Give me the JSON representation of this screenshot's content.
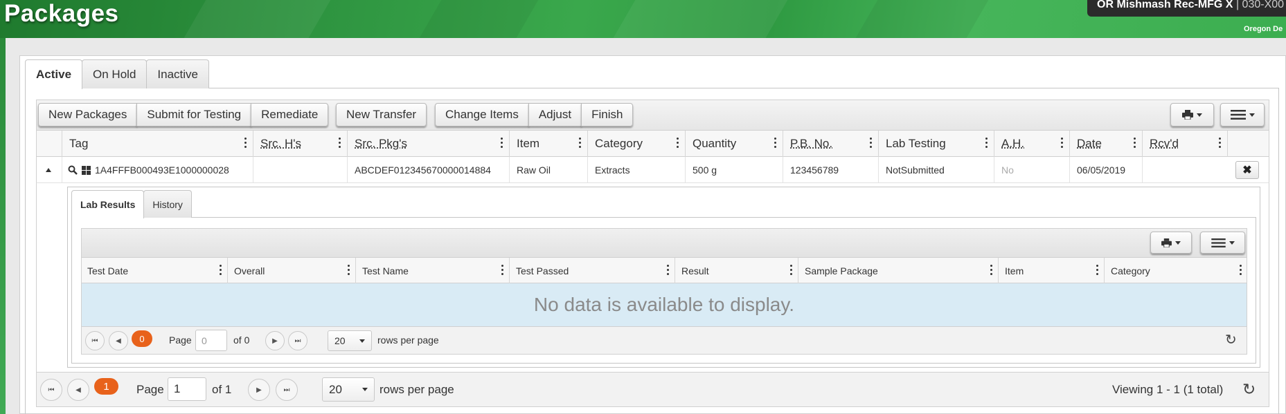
{
  "header": {
    "title": "Packages",
    "facility_name": "OR Mishmash Rec-MFG X",
    "facility_license": "| 030-X00",
    "state": "Oregon De"
  },
  "tabs": [
    {
      "label": "Active",
      "active": true
    },
    {
      "label": "On Hold",
      "active": false
    },
    {
      "label": "Inactive",
      "active": false
    }
  ],
  "toolbar": {
    "new_packages": "New Packages",
    "submit_for_testing": "Submit for Testing",
    "remediate": "Remediate",
    "new_transfer": "New Transfer",
    "change_items": "Change Items",
    "adjust": "Adjust",
    "finish": "Finish",
    "print_icon": "printer-icon",
    "menu_icon": "hamburger-icon"
  },
  "grid": {
    "columns": [
      "Tag",
      "Src. H's",
      "Src. Pkg's",
      "Item",
      "Category",
      "Quantity",
      "P.B. No.",
      "Lab Testing",
      "A.H.",
      "Date",
      "Rcv'd"
    ],
    "row": {
      "tag": "1A4FFFB000493E1000000028",
      "src_h": "",
      "src_pkg": "ABCDEF012345670000014884",
      "item": "Raw Oil",
      "category": "Extracts",
      "quantity": "500 g",
      "pb_no": "123456789",
      "lab_testing": "NotSubmitted",
      "ah": "No",
      "date": "06/05/2019",
      "rcvd": ""
    }
  },
  "detail": {
    "tabs": [
      {
        "label": "Lab Results",
        "active": true
      },
      {
        "label": "History",
        "active": false
      }
    ],
    "columns": [
      "Test Date",
      "Overall",
      "Test Name",
      "Test Passed",
      "Result",
      "Sample Package",
      "Item",
      "Category"
    ],
    "no_data": "No data is available to display.",
    "pager": {
      "current": "0",
      "page_label": "Page",
      "page_value": "0",
      "of_label": "of 0",
      "rows_value": "20",
      "rows_label": "rows per page"
    }
  },
  "pager": {
    "current": "1",
    "page_label": "Page",
    "page_value": "1",
    "of_label": "of 1",
    "rows_value": "20",
    "rows_label": "rows per page",
    "viewing": "Viewing 1 - 1 (1 total)"
  }
}
